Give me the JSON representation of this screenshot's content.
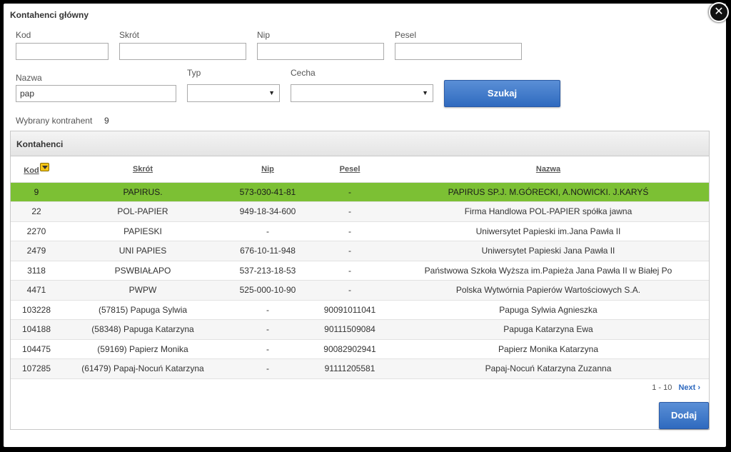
{
  "dialog": {
    "title": "Kontahenci główny",
    "close_glyph": "✕"
  },
  "filters": {
    "kod": {
      "label": "Kod",
      "value": ""
    },
    "skrot": {
      "label": "Skrót",
      "value": ""
    },
    "nip": {
      "label": "Nip",
      "value": ""
    },
    "pesel": {
      "label": "Pesel",
      "value": ""
    },
    "nazwa": {
      "label": "Nazwa",
      "value": "pap"
    },
    "typ": {
      "label": "Typ",
      "value": ""
    },
    "cecha": {
      "label": "Cecha",
      "value": ""
    },
    "search_button": "Szukaj"
  },
  "selected": {
    "label": "Wybrany kontrahent",
    "value": "9"
  },
  "panel": {
    "title": "Kontahenci"
  },
  "table": {
    "columns": [
      "Kod",
      "Skrót",
      "Nip",
      "Pesel",
      "Nazwa"
    ],
    "rows": [
      [
        "9",
        "PAPIRUS.",
        "573-030-41-81",
        "-",
        "PAPIRUS SP.J. M.GÓRECKI, A.NOWICKI. J.KARYŚ"
      ],
      [
        "22",
        "POL-PAPIER",
        "949-18-34-600",
        "-",
        "Firma Handlowa POL-PAPIER spółka jawna"
      ],
      [
        "2270",
        "PAPIESKI",
        "-",
        "-",
        "Uniwersytet Papieski im.Jana Pawła II"
      ],
      [
        "2479",
        "UNI PAPIES",
        "676-10-11-948",
        "-",
        "Uniwersytet Papieski Jana Pawła II"
      ],
      [
        "3118",
        "PSWBIAŁAPO",
        "537-213-18-53",
        "-",
        "Państwowa Szkoła Wyższa im.Papieża Jana Pawła II w Białej Po"
      ],
      [
        "4471",
        "PWPW",
        "525-000-10-90",
        "-",
        "Polska Wytwórnia Papierów Wartościowych S.A."
      ],
      [
        "103228",
        "(57815) Papuga Sylwia",
        "-",
        "90091011041",
        "Papuga Sylwia Agnieszka"
      ],
      [
        "104188",
        "(58348) Papuga Katarzyna",
        "-",
        "90111509084",
        "Papuga Katarzyna Ewa"
      ],
      [
        "104475",
        "(59169) Papierz Monika",
        "-",
        "90082902941",
        "Papierz Monika Katarzyna"
      ],
      [
        "107285",
        "(61479) Papaj-Nocuń Katarzyna",
        "-",
        "91111205581",
        "Papaj-Nocuń Katarzyna Zuzanna"
      ]
    ],
    "selected_row": 0
  },
  "pager": {
    "range": "1 - 10",
    "next_label": "Next ›"
  },
  "add_button": "Dodaj",
  "colors": {
    "selected_row": "#7cc034",
    "button_blue": "#2f6abf"
  }
}
